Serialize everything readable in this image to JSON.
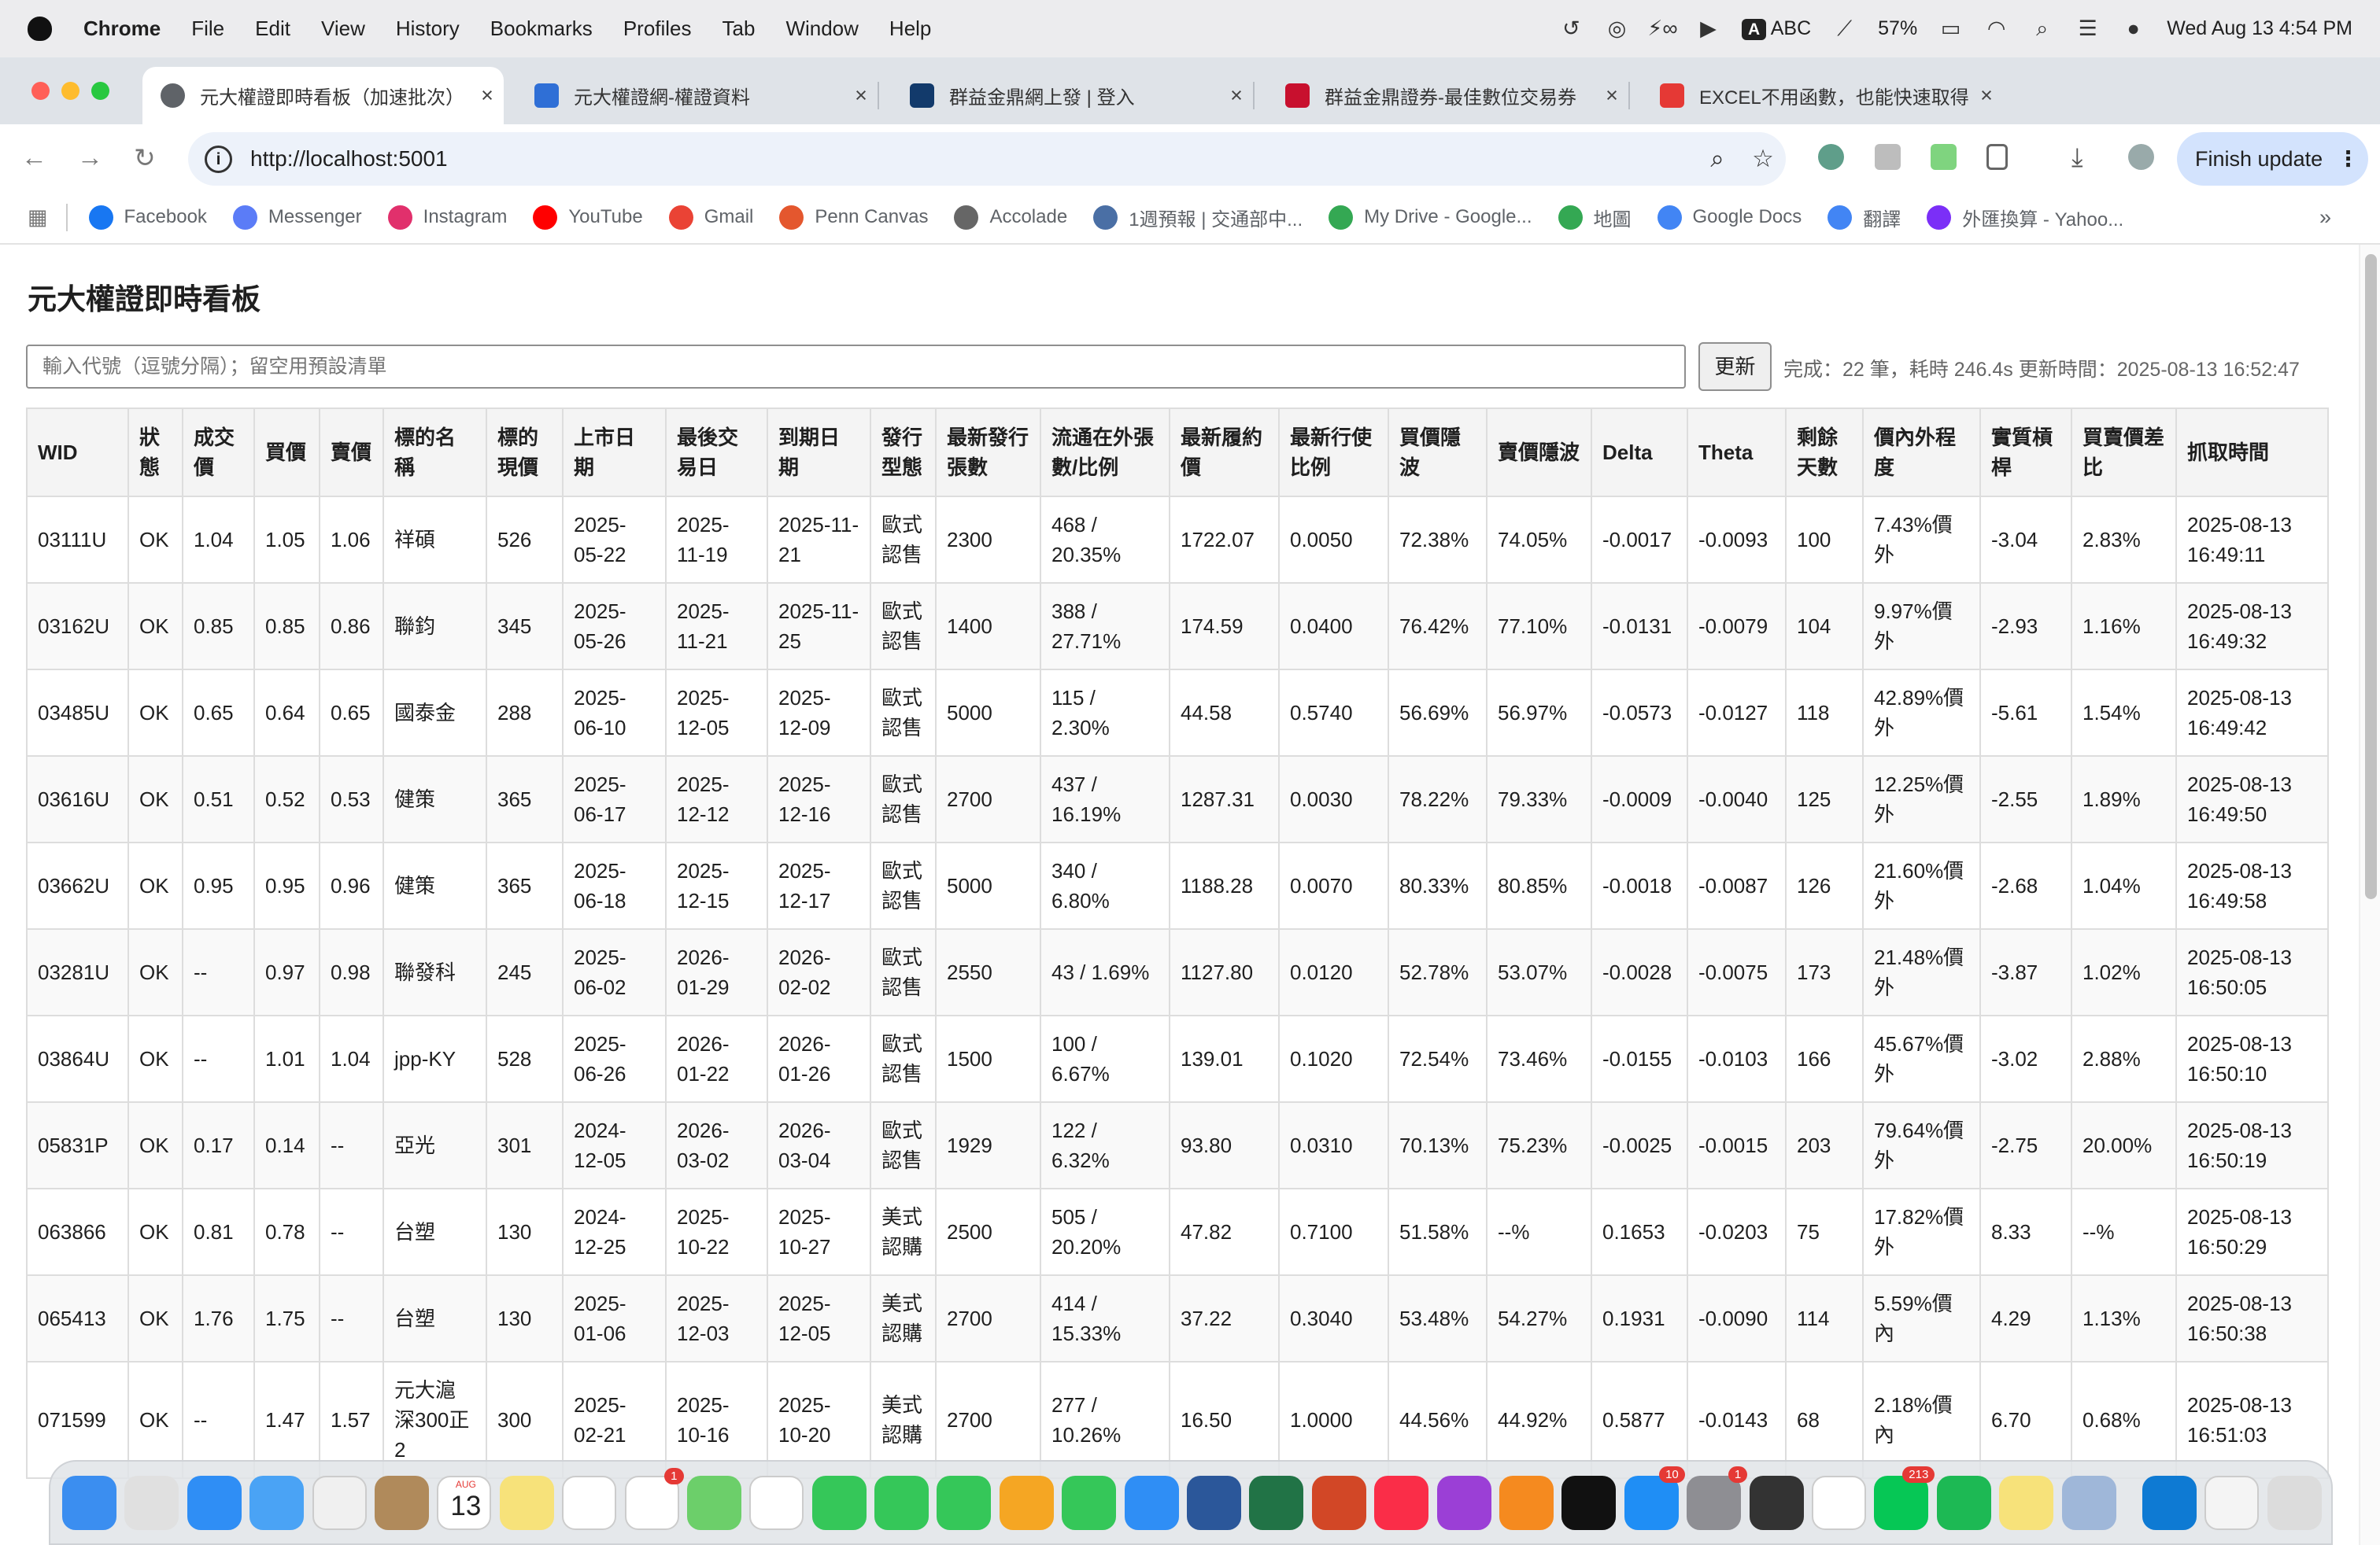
{
  "menubar": {
    "app": "Chrome",
    "items": [
      "File",
      "Edit",
      "View",
      "History",
      "Bookmarks",
      "Profiles",
      "Tab",
      "Window",
      "Help"
    ],
    "input_source": "ABC",
    "battery": "57%",
    "clock": "Wed Aug 13  4:54 PM"
  },
  "tabs": [
    {
      "title": "元大權證即時看板（加速批次）",
      "active": true,
      "color": "#5f6368"
    },
    {
      "title": "元大權證網-權證資料",
      "active": false,
      "color": "#2f6fd6"
    },
    {
      "title": "群益金鼎網上發 | 登入",
      "active": false,
      "color": "#123a6b"
    },
    {
      "title": "群益金鼎證券-最佳數位交易券",
      "active": false,
      "color": "#c8102e"
    },
    {
      "title": "EXCEL不用函數，也能快速取得",
      "active": false,
      "color": "#e53935"
    }
  ],
  "toolbar": {
    "url": "http://localhost:5001",
    "finish_update": "Finish update"
  },
  "bookmarks": [
    {
      "label": "Facebook",
      "color": "#1877f2"
    },
    {
      "label": "Messenger",
      "color": "#5b7cf7"
    },
    {
      "label": "Instagram",
      "color": "#e1306c"
    },
    {
      "label": "YouTube",
      "color": "#ff0000"
    },
    {
      "label": "Gmail",
      "color": "#ea4335"
    },
    {
      "label": "Penn Canvas",
      "color": "#e4572e"
    },
    {
      "label": "Accolade",
      "color": "#666666"
    },
    {
      "label": "1週預報 | 交通部中...",
      "color": "#4a6fa5"
    },
    {
      "label": "My Drive - Google...",
      "color": "#34a853"
    },
    {
      "label": "地圖",
      "color": "#34a853"
    },
    {
      "label": "Google Docs",
      "color": "#4285f4"
    },
    {
      "label": "翻譯",
      "color": "#4285f4"
    },
    {
      "label": "外匯換算 - Yahoo...",
      "color": "#7b2ff7"
    }
  ],
  "page": {
    "title": "元大權證即時看板",
    "search_placeholder": "輸入代號（逗號分隔）；留空用預設清單",
    "refresh_label": "更新",
    "status": "完成：22 筆，耗時 246.4s  更新時間：2025-08-13 16:52:47"
  },
  "table": {
    "headers": [
      "WID",
      "狀態",
      "成交價",
      "買價",
      "賣價",
      "標的名稱",
      "標的現價",
      "上市日期",
      "最後交易日",
      "到期日期",
      "發行型態",
      "最新發行張數",
      "流通在外張數/比例",
      "最新履約價",
      "最新行使比例",
      "買價隱波",
      "賣價隱波",
      "Delta",
      "Theta",
      "剩餘天數",
      "價內外程度",
      "實質槓桿",
      "買賣價差比",
      "抓取時間"
    ],
    "rows": [
      [
        "03111U",
        "OK",
        "1.04",
        "1.05",
        "1.06",
        "祥碩",
        "526",
        "2025-05-22",
        "2025-11-19",
        "2025-11-21",
        "歐式認售",
        "2300",
        "468 / 20.35%",
        "1722.07",
        "0.0050",
        "72.38%",
        "74.05%",
        "-0.0017",
        "-0.0093",
        "100",
        "7.43%價外",
        "-3.04",
        "2.83%",
        "2025-08-13 16:49:11"
      ],
      [
        "03162U",
        "OK",
        "0.85",
        "0.85",
        "0.86",
        "聯鈞",
        "345",
        "2025-05-26",
        "2025-11-21",
        "2025-11-25",
        "歐式認售",
        "1400",
        "388 / 27.71%",
        "174.59",
        "0.0400",
        "76.42%",
        "77.10%",
        "-0.0131",
        "-0.0079",
        "104",
        "9.97%價外",
        "-2.93",
        "1.16%",
        "2025-08-13 16:49:32"
      ],
      [
        "03485U",
        "OK",
        "0.65",
        "0.64",
        "0.65",
        "國泰金",
        "288",
        "2025-06-10",
        "2025-12-05",
        "2025-12-09",
        "歐式認售",
        "5000",
        "115 / 2.30%",
        "44.58",
        "0.5740",
        "56.69%",
        "56.97%",
        "-0.0573",
        "-0.0127",
        "118",
        "42.89%價外",
        "-5.61",
        "1.54%",
        "2025-08-13 16:49:42"
      ],
      [
        "03616U",
        "OK",
        "0.51",
        "0.52",
        "0.53",
        "健策",
        "365",
        "2025-06-17",
        "2025-12-12",
        "2025-12-16",
        "歐式認售",
        "2700",
        "437 / 16.19%",
        "1287.31",
        "0.0030",
        "78.22%",
        "79.33%",
        "-0.0009",
        "-0.0040",
        "125",
        "12.25%價外",
        "-2.55",
        "1.89%",
        "2025-08-13 16:49:50"
      ],
      [
        "03662U",
        "OK",
        "0.95",
        "0.95",
        "0.96",
        "健策",
        "365",
        "2025-06-18",
        "2025-12-15",
        "2025-12-17",
        "歐式認售",
        "5000",
        "340 / 6.80%",
        "1188.28",
        "0.0070",
        "80.33%",
        "80.85%",
        "-0.0018",
        "-0.0087",
        "126",
        "21.60%價外",
        "-2.68",
        "1.04%",
        "2025-08-13 16:49:58"
      ],
      [
        "03281U",
        "OK",
        "--",
        "0.97",
        "0.98",
        "聯發科",
        "245",
        "2025-06-02",
        "2026-01-29",
        "2026-02-02",
        "歐式認售",
        "2550",
        "43 / 1.69%",
        "1127.80",
        "0.0120",
        "52.78%",
        "53.07%",
        "-0.0028",
        "-0.0075",
        "173",
        "21.48%價外",
        "-3.87",
        "1.02%",
        "2025-08-13 16:50:05"
      ],
      [
        "03864U",
        "OK",
        "--",
        "1.01",
        "1.04",
        "jpp-KY",
        "528",
        "2025-06-26",
        "2026-01-22",
        "2026-01-26",
        "歐式認售",
        "1500",
        "100 / 6.67%",
        "139.01",
        "0.1020",
        "72.54%",
        "73.46%",
        "-0.0155",
        "-0.0103",
        "166",
        "45.67%價外",
        "-3.02",
        "2.88%",
        "2025-08-13 16:50:10"
      ],
      [
        "05831P",
        "OK",
        "0.17",
        "0.14",
        "--",
        "亞光",
        "301",
        "2024-12-05",
        "2026-03-02",
        "2026-03-04",
        "歐式認售",
        "1929",
        "122 / 6.32%",
        "93.80",
        "0.0310",
        "70.13%",
        "75.23%",
        "-0.0025",
        "-0.0015",
        "203",
        "79.64%價外",
        "-2.75",
        "20.00%",
        "2025-08-13 16:50:19"
      ],
      [
        "063866",
        "OK",
        "0.81",
        "0.78",
        "--",
        "台塑",
        "130",
        "2024-12-25",
        "2025-10-22",
        "2025-10-27",
        "美式認購",
        "2500",
        "505 / 20.20%",
        "47.82",
        "0.7100",
        "51.58%",
        "--%",
        "0.1653",
        "-0.0203",
        "75",
        "17.82%價外",
        "8.33",
        "--%",
        "2025-08-13 16:50:29"
      ],
      [
        "065413",
        "OK",
        "1.76",
        "1.75",
        "--",
        "台塑",
        "130",
        "2025-01-06",
        "2025-12-03",
        "2025-12-05",
        "美式認購",
        "2700",
        "414 / 15.33%",
        "37.22",
        "0.3040",
        "53.48%",
        "54.27%",
        "0.1931",
        "-0.0090",
        "114",
        "5.59%價內",
        "4.29",
        "1.13%",
        "2025-08-13 16:50:38"
      ],
      [
        "071599",
        "OK",
        "--",
        "1.47",
        "1.57",
        "元大滬深300正2",
        "300",
        "2025-02-21",
        "2025-10-16",
        "2025-10-20",
        "美式認購",
        "2700",
        "277 / 10.26%",
        "16.50",
        "1.0000",
        "44.56%",
        "44.92%",
        "0.5877",
        "-0.0143",
        "68",
        "2.18%價內",
        "6.70",
        "0.68%",
        "2025-08-13 16:51:03"
      ]
    ]
  },
  "dock": {
    "calendar_month": "AUG",
    "calendar_day": "13",
    "items": [
      {
        "name": "finder",
        "color": "#3b8ef0"
      },
      {
        "name": "launchpad",
        "color": "#e0e0e0"
      },
      {
        "name": "safari",
        "color": "#2f8ef5"
      },
      {
        "name": "mail",
        "color": "#4aa3f5"
      },
      {
        "name": "app",
        "color": "#f0f0f0"
      },
      {
        "name": "contacts",
        "color": "#b08a5b"
      },
      {
        "name": "calendar",
        "color": "#ffffff"
      },
      {
        "name": "notes",
        "color": "#f7e27a"
      },
      {
        "name": "freeform",
        "color": "#ffffff"
      },
      {
        "name": "reminders",
        "color": "#ffffff",
        "badge": "1"
      },
      {
        "name": "maps",
        "color": "#6ccf6a"
      },
      {
        "name": "photos",
        "color": "#ffffff"
      },
      {
        "name": "facetime",
        "color": "#35c759"
      },
      {
        "name": "messages",
        "color": "#35c759"
      },
      {
        "name": "find-my",
        "color": "#35c759"
      },
      {
        "name": "pages",
        "color": "#f5a623"
      },
      {
        "name": "numbers",
        "color": "#35c759"
      },
      {
        "name": "keynote",
        "color": "#2f8ef5"
      },
      {
        "name": "word",
        "color": "#2b579a"
      },
      {
        "name": "excel",
        "color": "#217346"
      },
      {
        "name": "powerpoint",
        "color": "#d24726"
      },
      {
        "name": "music",
        "color": "#fa2d48"
      },
      {
        "name": "podcasts",
        "color": "#9b3fd6"
      },
      {
        "name": "books",
        "color": "#f58a1f"
      },
      {
        "name": "tv",
        "color": "#111111"
      },
      {
        "name": "app-store",
        "color": "#1f8ef5",
        "badge": "10"
      },
      {
        "name": "system-settings",
        "color": "#8e8e93",
        "badge": "1"
      },
      {
        "name": "calculator",
        "color": "#333333"
      },
      {
        "name": "chrome",
        "color": "#ffffff"
      },
      {
        "name": "line",
        "color": "#06c755",
        "badge": "213"
      },
      {
        "name": "spotify",
        "color": "#1db954"
      },
      {
        "name": "stickies",
        "color": "#f7e27a"
      },
      {
        "name": "preview",
        "color": "#9fb7d9"
      },
      {
        "name": "vscode",
        "color": "#0e7ad3"
      },
      {
        "name": "documents",
        "color": "#f4f4f4"
      },
      {
        "name": "trash",
        "color": "#dcdcdc"
      }
    ]
  }
}
